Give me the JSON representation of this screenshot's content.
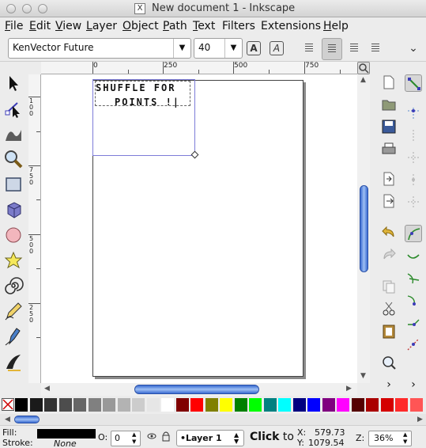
{
  "window": {
    "title": "New document 1 - Inkscape",
    "x_icon": "X"
  },
  "menu": [
    {
      "label": "File",
      "u": "F",
      "rest": "ile"
    },
    {
      "label": "Edit",
      "u": "E",
      "rest": "dit"
    },
    {
      "label": "View",
      "u": "V",
      "rest": "iew"
    },
    {
      "label": "Layer",
      "u": "L",
      "rest": "ayer"
    },
    {
      "label": "Object",
      "u": "O",
      "rest": "bject"
    },
    {
      "label": "Path",
      "u": "P",
      "rest": "ath"
    },
    {
      "label": "Text",
      "u": "T",
      "rest": "ext"
    },
    {
      "label": "Filters",
      "u": "",
      "rest": "Filters"
    },
    {
      "label": "Extensions",
      "u": "",
      "rest": "Extensions"
    },
    {
      "label": "Help",
      "u": "H",
      "rest": "elp"
    }
  ],
  "text_toolbar": {
    "font_family": "KenVector Future",
    "font_size": "40",
    "bold_glyph": "A",
    "italic_glyph": "A",
    "align_selected": "center",
    "more_glyph": "⌄"
  },
  "ruler_top": [
    "0",
    "250",
    "500",
    "750"
  ],
  "ruler_left": [
    "1\n0\n0",
    "7\n5\n0",
    "5\n0\n0",
    "2\n5\n0"
  ],
  "canvas": {
    "text_line1": "SHUFFLE FOR",
    "text_line2": "POINTS !|"
  },
  "tools": [
    "selector-tool",
    "node-tool",
    "tweak-tool",
    "zoom-tool",
    "rect-tool",
    "3dbox-tool",
    "ellipse-tool",
    "star-tool",
    "spiral-tool",
    "pencil-tool",
    "pen-tool",
    "calligraphy-tool"
  ],
  "palette_colors": [
    "#000000",
    "#1a1a1a",
    "#333333",
    "#4d4d4d",
    "#666666",
    "#808080",
    "#999999",
    "#b3b3b3",
    "#cccccc",
    "#e6e6e6",
    "#ffffff",
    "#800000",
    "#ff0000",
    "#808000",
    "#ffff00",
    "#008000",
    "#00ff00",
    "#008080",
    "#00ffff",
    "#000080",
    "#0000ff",
    "#800080",
    "#ff00ff",
    "#550000",
    "#aa0000",
    "#d40000",
    "#ff2a2a",
    "#ff5555"
  ],
  "status": {
    "fill_label": "Fill:",
    "stroke_label": "Stroke:",
    "stroke_value": "None",
    "opacity_label": "O:",
    "opacity_value": "0",
    "layer_value": "•Layer 1",
    "message_bold": "Click",
    "message_rest": " to",
    "x_label": "X:",
    "x_value": "579.73",
    "y_label": "Y:",
    "y_value": "1079.54",
    "zoom_label": "Z:",
    "zoom_value": "36%"
  }
}
